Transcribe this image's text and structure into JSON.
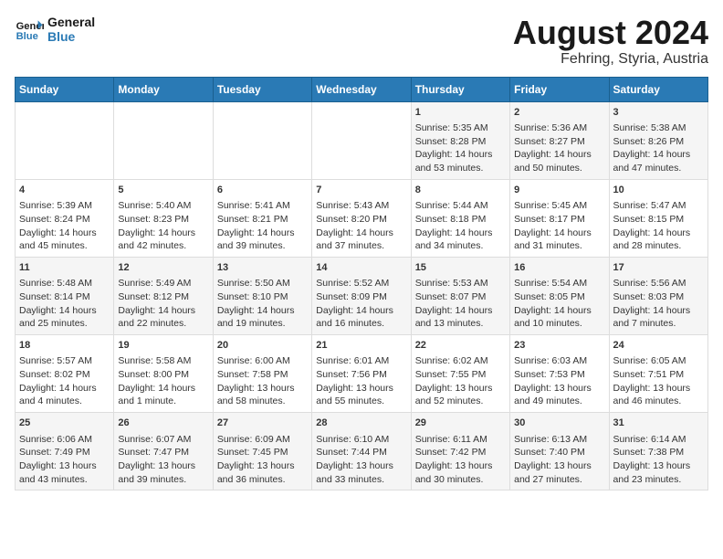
{
  "header": {
    "logo_line1": "General",
    "logo_line2": "Blue",
    "title": "August 2024",
    "subtitle": "Fehring, Styria, Austria"
  },
  "weekdays": [
    "Sunday",
    "Monday",
    "Tuesday",
    "Wednesday",
    "Thursday",
    "Friday",
    "Saturday"
  ],
  "weeks": [
    [
      {
        "day": "",
        "info": ""
      },
      {
        "day": "",
        "info": ""
      },
      {
        "day": "",
        "info": ""
      },
      {
        "day": "",
        "info": ""
      },
      {
        "day": "1",
        "info": "Sunrise: 5:35 AM\nSunset: 8:28 PM\nDaylight: 14 hours\nand 53 minutes."
      },
      {
        "day": "2",
        "info": "Sunrise: 5:36 AM\nSunset: 8:27 PM\nDaylight: 14 hours\nand 50 minutes."
      },
      {
        "day": "3",
        "info": "Sunrise: 5:38 AM\nSunset: 8:26 PM\nDaylight: 14 hours\nand 47 minutes."
      }
    ],
    [
      {
        "day": "4",
        "info": "Sunrise: 5:39 AM\nSunset: 8:24 PM\nDaylight: 14 hours\nand 45 minutes."
      },
      {
        "day": "5",
        "info": "Sunrise: 5:40 AM\nSunset: 8:23 PM\nDaylight: 14 hours\nand 42 minutes."
      },
      {
        "day": "6",
        "info": "Sunrise: 5:41 AM\nSunset: 8:21 PM\nDaylight: 14 hours\nand 39 minutes."
      },
      {
        "day": "7",
        "info": "Sunrise: 5:43 AM\nSunset: 8:20 PM\nDaylight: 14 hours\nand 37 minutes."
      },
      {
        "day": "8",
        "info": "Sunrise: 5:44 AM\nSunset: 8:18 PM\nDaylight: 14 hours\nand 34 minutes."
      },
      {
        "day": "9",
        "info": "Sunrise: 5:45 AM\nSunset: 8:17 PM\nDaylight: 14 hours\nand 31 minutes."
      },
      {
        "day": "10",
        "info": "Sunrise: 5:47 AM\nSunset: 8:15 PM\nDaylight: 14 hours\nand 28 minutes."
      }
    ],
    [
      {
        "day": "11",
        "info": "Sunrise: 5:48 AM\nSunset: 8:14 PM\nDaylight: 14 hours\nand 25 minutes."
      },
      {
        "day": "12",
        "info": "Sunrise: 5:49 AM\nSunset: 8:12 PM\nDaylight: 14 hours\nand 22 minutes."
      },
      {
        "day": "13",
        "info": "Sunrise: 5:50 AM\nSunset: 8:10 PM\nDaylight: 14 hours\nand 19 minutes."
      },
      {
        "day": "14",
        "info": "Sunrise: 5:52 AM\nSunset: 8:09 PM\nDaylight: 14 hours\nand 16 minutes."
      },
      {
        "day": "15",
        "info": "Sunrise: 5:53 AM\nSunset: 8:07 PM\nDaylight: 14 hours\nand 13 minutes."
      },
      {
        "day": "16",
        "info": "Sunrise: 5:54 AM\nSunset: 8:05 PM\nDaylight: 14 hours\nand 10 minutes."
      },
      {
        "day": "17",
        "info": "Sunrise: 5:56 AM\nSunset: 8:03 PM\nDaylight: 14 hours\nand 7 minutes."
      }
    ],
    [
      {
        "day": "18",
        "info": "Sunrise: 5:57 AM\nSunset: 8:02 PM\nDaylight: 14 hours\nand 4 minutes."
      },
      {
        "day": "19",
        "info": "Sunrise: 5:58 AM\nSunset: 8:00 PM\nDaylight: 14 hours\nand 1 minute."
      },
      {
        "day": "20",
        "info": "Sunrise: 6:00 AM\nSunset: 7:58 PM\nDaylight: 13 hours\nand 58 minutes."
      },
      {
        "day": "21",
        "info": "Sunrise: 6:01 AM\nSunset: 7:56 PM\nDaylight: 13 hours\nand 55 minutes."
      },
      {
        "day": "22",
        "info": "Sunrise: 6:02 AM\nSunset: 7:55 PM\nDaylight: 13 hours\nand 52 minutes."
      },
      {
        "day": "23",
        "info": "Sunrise: 6:03 AM\nSunset: 7:53 PM\nDaylight: 13 hours\nand 49 minutes."
      },
      {
        "day": "24",
        "info": "Sunrise: 6:05 AM\nSunset: 7:51 PM\nDaylight: 13 hours\nand 46 minutes."
      }
    ],
    [
      {
        "day": "25",
        "info": "Sunrise: 6:06 AM\nSunset: 7:49 PM\nDaylight: 13 hours\nand 43 minutes."
      },
      {
        "day": "26",
        "info": "Sunrise: 6:07 AM\nSunset: 7:47 PM\nDaylight: 13 hours\nand 39 minutes."
      },
      {
        "day": "27",
        "info": "Sunrise: 6:09 AM\nSunset: 7:45 PM\nDaylight: 13 hours\nand 36 minutes."
      },
      {
        "day": "28",
        "info": "Sunrise: 6:10 AM\nSunset: 7:44 PM\nDaylight: 13 hours\nand 33 minutes."
      },
      {
        "day": "29",
        "info": "Sunrise: 6:11 AM\nSunset: 7:42 PM\nDaylight: 13 hours\nand 30 minutes."
      },
      {
        "day": "30",
        "info": "Sunrise: 6:13 AM\nSunset: 7:40 PM\nDaylight: 13 hours\nand 27 minutes."
      },
      {
        "day": "31",
        "info": "Sunrise: 6:14 AM\nSunset: 7:38 PM\nDaylight: 13 hours\nand 23 minutes."
      }
    ]
  ]
}
